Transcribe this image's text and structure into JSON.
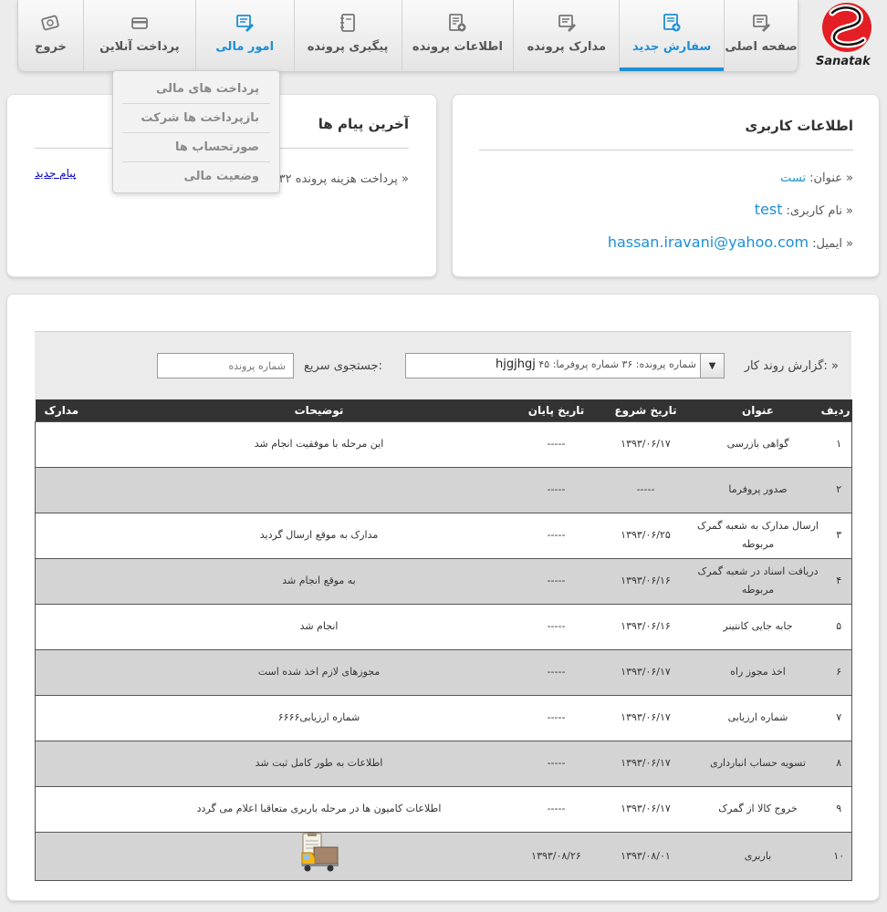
{
  "brand": {
    "logo_text": "Sanatak",
    "colors": {
      "logo_red": "#e31e24",
      "accent": "#1d8fd6"
    }
  },
  "nav": {
    "items": [
      {
        "label": "صفحه اصلی",
        "icon": "document-edit-icon"
      },
      {
        "label": "سفارش جدید",
        "icon": "add-order-icon"
      },
      {
        "label": "مدارک پرونده",
        "icon": "document-edit-icon"
      },
      {
        "label": "اطلاعات پرونده",
        "icon": "file-info-icon"
      },
      {
        "label": "پیگیری پرونده",
        "icon": "notebook-icon"
      },
      {
        "label": "امور مالی",
        "icon": "document-edit-icon"
      },
      {
        "label": "پرداخت آنلاین",
        "icon": "credit-card-icon"
      },
      {
        "label": "خروج",
        "icon": "exit-icon"
      }
    ],
    "dropdown": [
      "پرداخت های مالی",
      "بازپرداخت ها شرکت",
      "صورتحساب ها",
      "وضعیت مالی"
    ]
  },
  "user_panel": {
    "title": "اطلاعات کاربری",
    "rows": [
      {
        "label": "عنوان:",
        "value": "تست"
      },
      {
        "label": "نام کاربری:",
        "value": "test"
      },
      {
        "label": "ایمیل:",
        "value": "hassan.iravani@yahoo.com"
      }
    ]
  },
  "messages_panel": {
    "title": "آخرین پیام ها",
    "items": [
      "پرداخت هزینه پرونده ۳۲"
    ],
    "new_message_link": "پیام جدید"
  },
  "report": {
    "workflow_label": ":گزارش روند کار",
    "select_prefix": "شماره پرونده: ۳۶ شماره پروفرما: ۴۵",
    "select_value": "hjgjhgj",
    "quick_search_label": ":جستجوی سریع",
    "search_placeholder": "شماره پرونده",
    "columns": [
      "ردیف",
      "عنوان",
      "تاریخ شروع",
      "تاریخ پایان",
      "توضیحات",
      "مدارک"
    ],
    "rows": [
      {
        "num": "۱",
        "title": "گواهی بازرسی",
        "start": "۱۳۹۳/۰۶/۱۷",
        "end": "-----",
        "desc": "این مرحله با موفقیت انجام شد",
        "doc": ""
      },
      {
        "num": "۲",
        "title": "صدور پروفرما",
        "start": "-----",
        "end": "-----",
        "desc": "",
        "doc": ""
      },
      {
        "num": "۳",
        "title": "ارسال مدارک به شعبه گمرک مربوطه",
        "start": "۱۳۹۳/۰۶/۲۵",
        "end": "-----",
        "desc": "مدارک به موقع ارسال گردید",
        "doc": ""
      },
      {
        "num": "۴",
        "title": "دریافت اسناد در شعبه گمرک مربوطه",
        "start": "۱۳۹۳/۰۶/۱۶",
        "end": "-----",
        "desc": "به موقع انجام شد",
        "doc": ""
      },
      {
        "num": "۵",
        "title": "جابه جایی کانتینر",
        "start": "۱۳۹۳/۰۶/۱۶",
        "end": "-----",
        "desc": "انجام شد",
        "doc": ""
      },
      {
        "num": "۶",
        "title": "اخذ مجوز راه",
        "start": "۱۳۹۳/۰۶/۱۷",
        "end": "-----",
        "desc": "مجوزهای لازم اخذ شده است",
        "doc": ""
      },
      {
        "num": "۷",
        "title": "شماره ارزیابی",
        "start": "۱۳۹۳/۰۶/۱۷",
        "end": "-----",
        "desc": "شماره ارزیابی۶۶۶۶",
        "doc": ""
      },
      {
        "num": "۸",
        "title": "تسویه حساب انبارداری",
        "start": "۱۳۹۳/۰۶/۱۷",
        "end": "-----",
        "desc": "اطلاعات به طور کامل ثبت شد",
        "doc": ""
      },
      {
        "num": "۹",
        "title": "خروج کالا از گمرک",
        "start": "۱۳۹۳/۰۶/۱۷",
        "end": "-----",
        "desc": "اطلاعات کامیون ها در مرحله باربری متعاقبا اعلام می گردد",
        "doc": ""
      },
      {
        "num": "۱۰",
        "title": "باربری",
        "start": "۱۳۹۳/۰۸/۰۱",
        "end": "۱۳۹۳/۰۸/۲۶",
        "desc": "",
        "doc": "truck-document-icon"
      }
    ]
  }
}
